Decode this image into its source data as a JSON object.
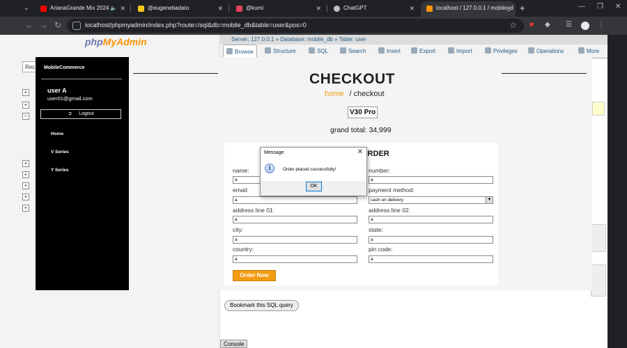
{
  "browser": {
    "tabs": [
      {
        "title": "ArianaGrande Mix 2024",
        "favicon_color": "#ff0000",
        "active": false
      },
      {
        "title": "@eugenebadato",
        "favicon_color": "#f5c518",
        "active": false
      },
      {
        "title": "@kumi",
        "favicon_color": "#e4405f",
        "active": false
      },
      {
        "title": "ChatGPT",
        "favicon_color": "#bdc1c6",
        "active": false
      },
      {
        "title": "localhost / 127.0.0.1 / mobile_d",
        "favicon_color": "#f89406",
        "active": true
      }
    ],
    "url": "localhost/phpmyadmin/index.php?route=/sql&db=mobile_db&table=user&pos=0",
    "icons": [
      "chevron-down-icon",
      "back-icon",
      "forward-icon",
      "reload-icon",
      "star-icon",
      "extensions-icon",
      "profile-icon"
    ]
  },
  "pma": {
    "logo_part1": "php",
    "logo_part2": "MyAdmin",
    "recent_label": "Rec",
    "breadcrumb": "Server: 127.0.0.1 » Database: mobile_db » Table: user",
    "tabs": [
      {
        "label": "Browse",
        "icon": "browse-icon"
      },
      {
        "label": "Structure",
        "icon": "structure-icon"
      },
      {
        "label": "SQL",
        "icon": "sql-icon"
      },
      {
        "label": "Search",
        "icon": "search-icon"
      },
      {
        "label": "Insert",
        "icon": "insert-icon"
      },
      {
        "label": "Export",
        "icon": "export-icon"
      },
      {
        "label": "Import",
        "icon": "import-icon"
      },
      {
        "label": "Privileges",
        "icon": "privileges-icon"
      },
      {
        "label": "Operations",
        "icon": "operations-icon"
      },
      {
        "label": "More",
        "icon": "chevron-down-icon"
      }
    ],
    "bookmark_label": "Bookmark this SQL query",
    "console_label": "Console"
  },
  "shop": {
    "brand": "MobileCommerce",
    "user_name": "user A",
    "user_email": "user01@gmail.com",
    "logout_label": "Logout",
    "nav": [
      "Home",
      "V Series",
      "Y Series"
    ],
    "page_title": "CHECKOUT",
    "breadcrumb_home": "home",
    "breadcrumb_current": "/ checkout",
    "product": "V30 Pro",
    "grand_total": "grand total: 34,999",
    "form": {
      "heading": "ORDER",
      "fields": [
        {
          "label": "name:",
          "value": "a"
        },
        {
          "label": "number:",
          "value": "a"
        },
        {
          "label": "email:",
          "value": "a"
        },
        {
          "label": "payment method:",
          "value": "cash on delivery"
        },
        {
          "label": "address line 01:",
          "value": "a"
        },
        {
          "label": "address line 02:",
          "value": "a"
        },
        {
          "label": "city:",
          "value": "a"
        },
        {
          "label": "state:",
          "value": "a"
        },
        {
          "label": "country:",
          "value": "a"
        },
        {
          "label": "pin code:",
          "value": "a"
        }
      ],
      "submit_label": "Order Now"
    },
    "accent_color": "#f39c12"
  },
  "dialog": {
    "title": "Message",
    "message": "Order placed successfully!",
    "ok_label": "OK",
    "icon": "info-icon"
  }
}
